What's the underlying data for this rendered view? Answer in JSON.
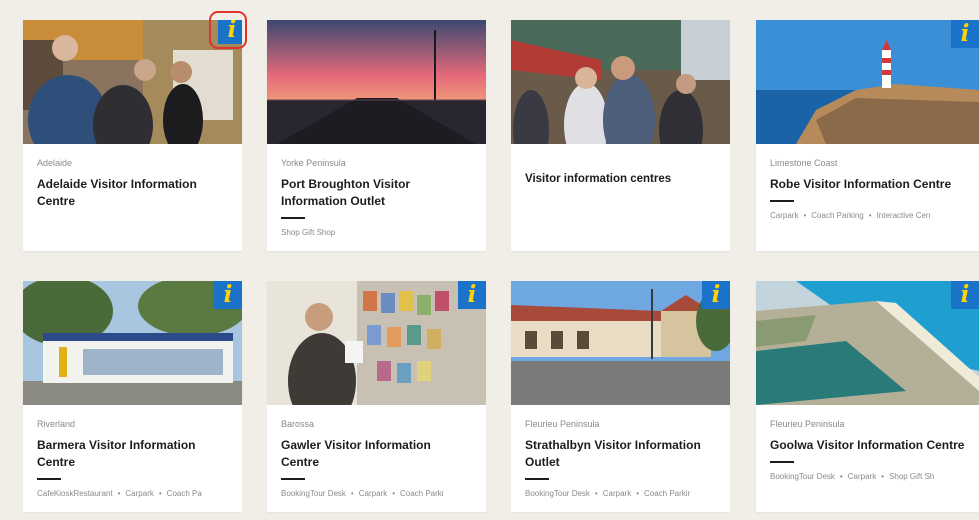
{
  "cards": [
    {
      "region": "Adelaide",
      "title": "Adelaide Visitor Information Centre",
      "tags": []
    },
    {
      "region": "Yorke Peninsula",
      "title": "Port Broughton Visitor Information Outlet",
      "tags": [
        "Shop Gift Shop"
      ]
    },
    {
      "region": "",
      "title": "Visitor information centres",
      "tags": []
    },
    {
      "region": "Limestone Coast",
      "title": "Robe Visitor Information Centre",
      "tags": [
        "Carpark",
        "Coach Parking",
        "Interactive Cen"
      ]
    },
    {
      "region": "Riverland",
      "title": "Barmera Visitor Information Centre",
      "tags": [
        "CafeKioskRestaurant",
        "Carpark",
        "Coach Pa"
      ]
    },
    {
      "region": "Barossa",
      "title": "Gawler Visitor Information Centre",
      "tags": [
        "BookingTour Desk",
        "Carpark",
        "Coach Parki"
      ]
    },
    {
      "region": "Fleurieu Peninsula",
      "title": "Strathalbyn Visitor Information Outlet",
      "tags": [
        "BookingTour Desk",
        "Carpark",
        "Coach Parkir"
      ]
    },
    {
      "region": "Fleurieu Peninsula",
      "title": "Goolwa Visitor Information Centre",
      "tags": [
        "BookingTour Desk",
        "Carpark",
        "Shop Gift Sh"
      ]
    }
  ],
  "badge_glyph": "i",
  "colors": {
    "badge_bg": "#1a73c8",
    "badge_glyph": "#ffd400",
    "highlight_ring": "#e0322e"
  }
}
